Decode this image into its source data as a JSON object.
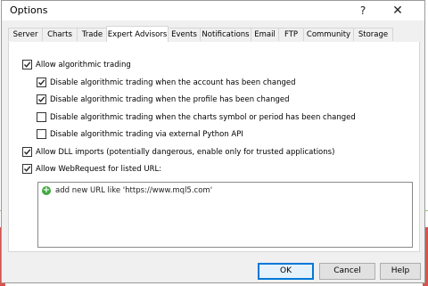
{
  "dialog": {
    "title": "Options",
    "help_glyph": "?",
    "close_glyph": "✕"
  },
  "tabs": [
    {
      "label": "Server"
    },
    {
      "label": "Charts"
    },
    {
      "label": "Trade"
    },
    {
      "label": "Expert Advisors",
      "active": true
    },
    {
      "label": "Events"
    },
    {
      "label": "Notifications"
    },
    {
      "label": "Email"
    },
    {
      "label": "FTP"
    },
    {
      "label": "Community"
    },
    {
      "label": "Storage"
    }
  ],
  "options": {
    "allow_algo": {
      "label": "Allow algorithmic trading",
      "checked": true
    },
    "disable_account": {
      "label": "Disable algorithmic trading when the account has been changed",
      "checked": true
    },
    "disable_profile": {
      "label": "Disable algorithmic trading when the profile has been changed",
      "checked": true
    },
    "disable_symbol": {
      "label": "Disable algorithmic trading when the charts symbol or period has been changed",
      "checked": false
    },
    "disable_python": {
      "label": "Disable algorithmic trading via external Python API",
      "checked": false
    },
    "allow_dll": {
      "label": "Allow DLL imports (potentially dangerous, enable only for trusted applications)",
      "checked": true
    },
    "allow_webrequest": {
      "label": "Allow WebRequest for listed URL:",
      "checked": true
    }
  },
  "url_list": {
    "add_label": "add new URL like 'https://www.mql5.com'",
    "icon": "plus-icon"
  },
  "buttons": {
    "ok": "OK",
    "cancel": "Cancel",
    "help": "Help"
  },
  "colors": {
    "accent": "#0078d7",
    "add_icon": "#3fa83f"
  }
}
